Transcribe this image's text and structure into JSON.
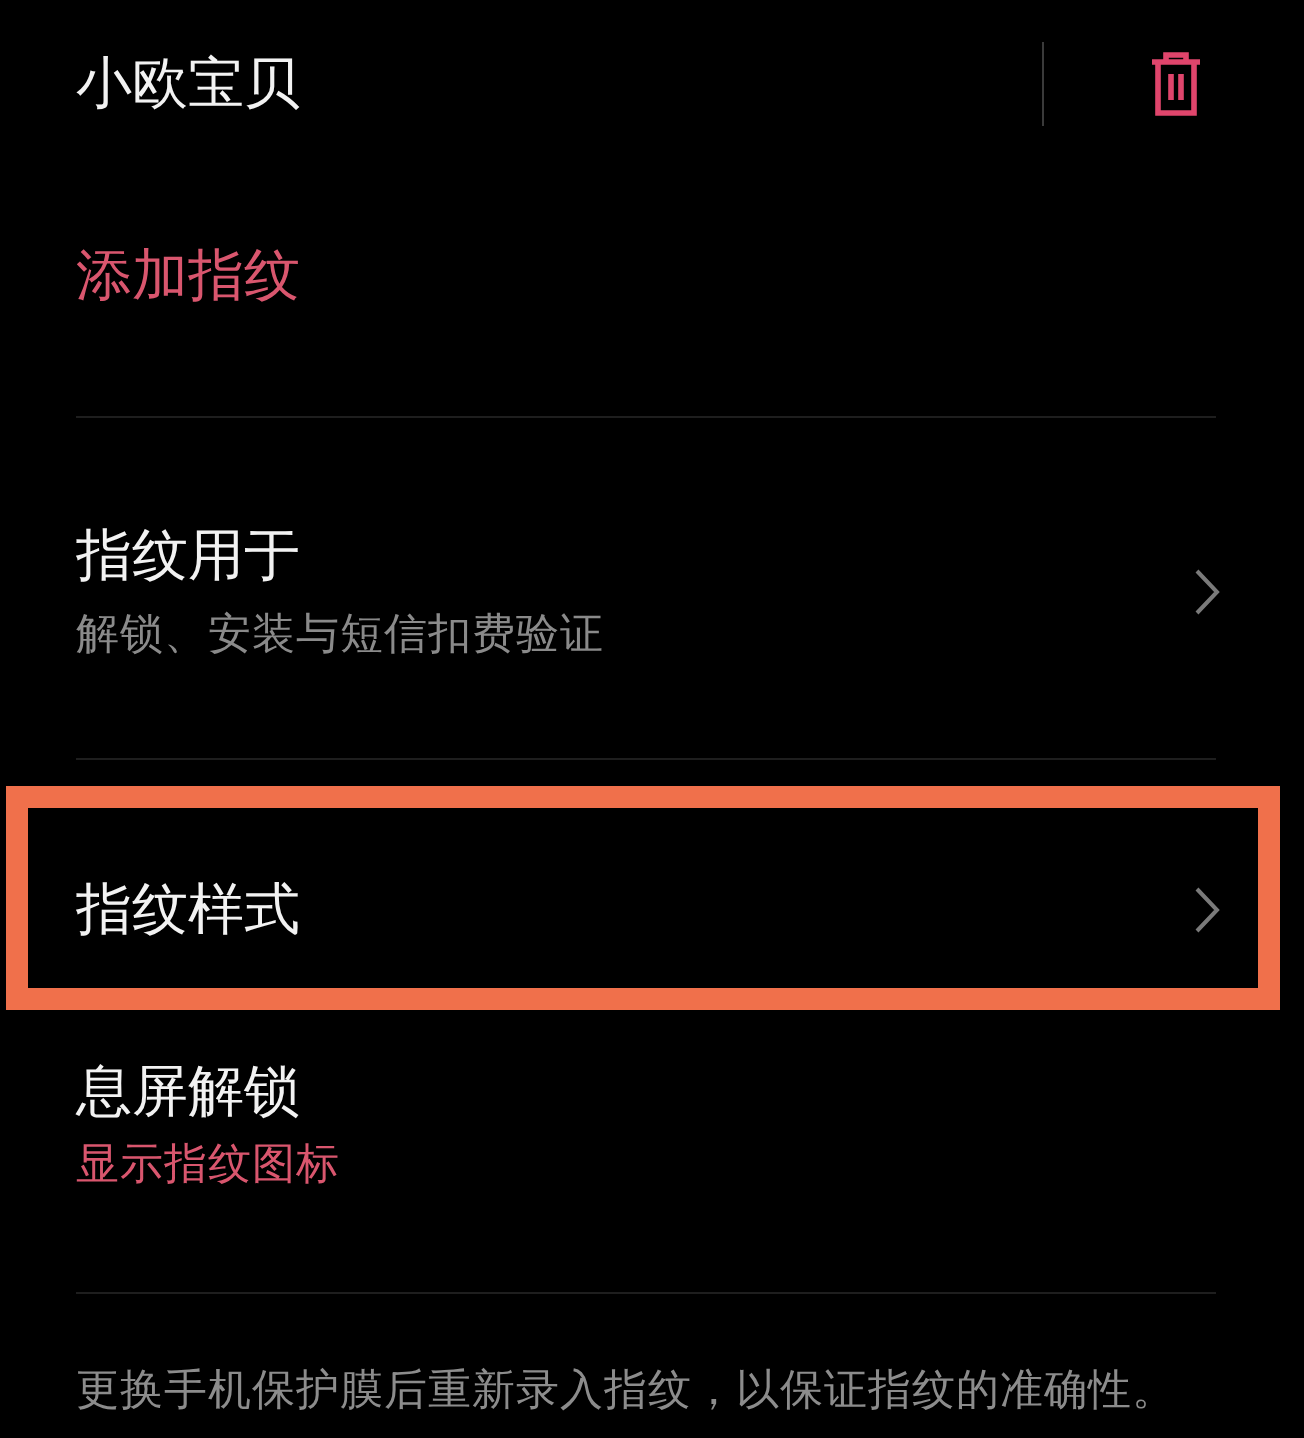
{
  "header": {
    "title": "小欧宝贝"
  },
  "add_fingerprint": {
    "label": "添加指纹"
  },
  "items": [
    {
      "kind": "detail",
      "title": "指纹用于",
      "subtitle": "解锁、安装与短信扣费验证",
      "chevron": true,
      "highlighted": false
    },
    {
      "kind": "plain",
      "title": "指纹样式",
      "chevron": true,
      "highlighted": true
    },
    {
      "kind": "value",
      "title": "息屏解锁",
      "subtitle": "显示指纹图标",
      "chevron": false,
      "highlighted": false
    }
  ],
  "footnote": "更换手机保护膜后重新录入指纹，以保证指纹的准确性。"
}
